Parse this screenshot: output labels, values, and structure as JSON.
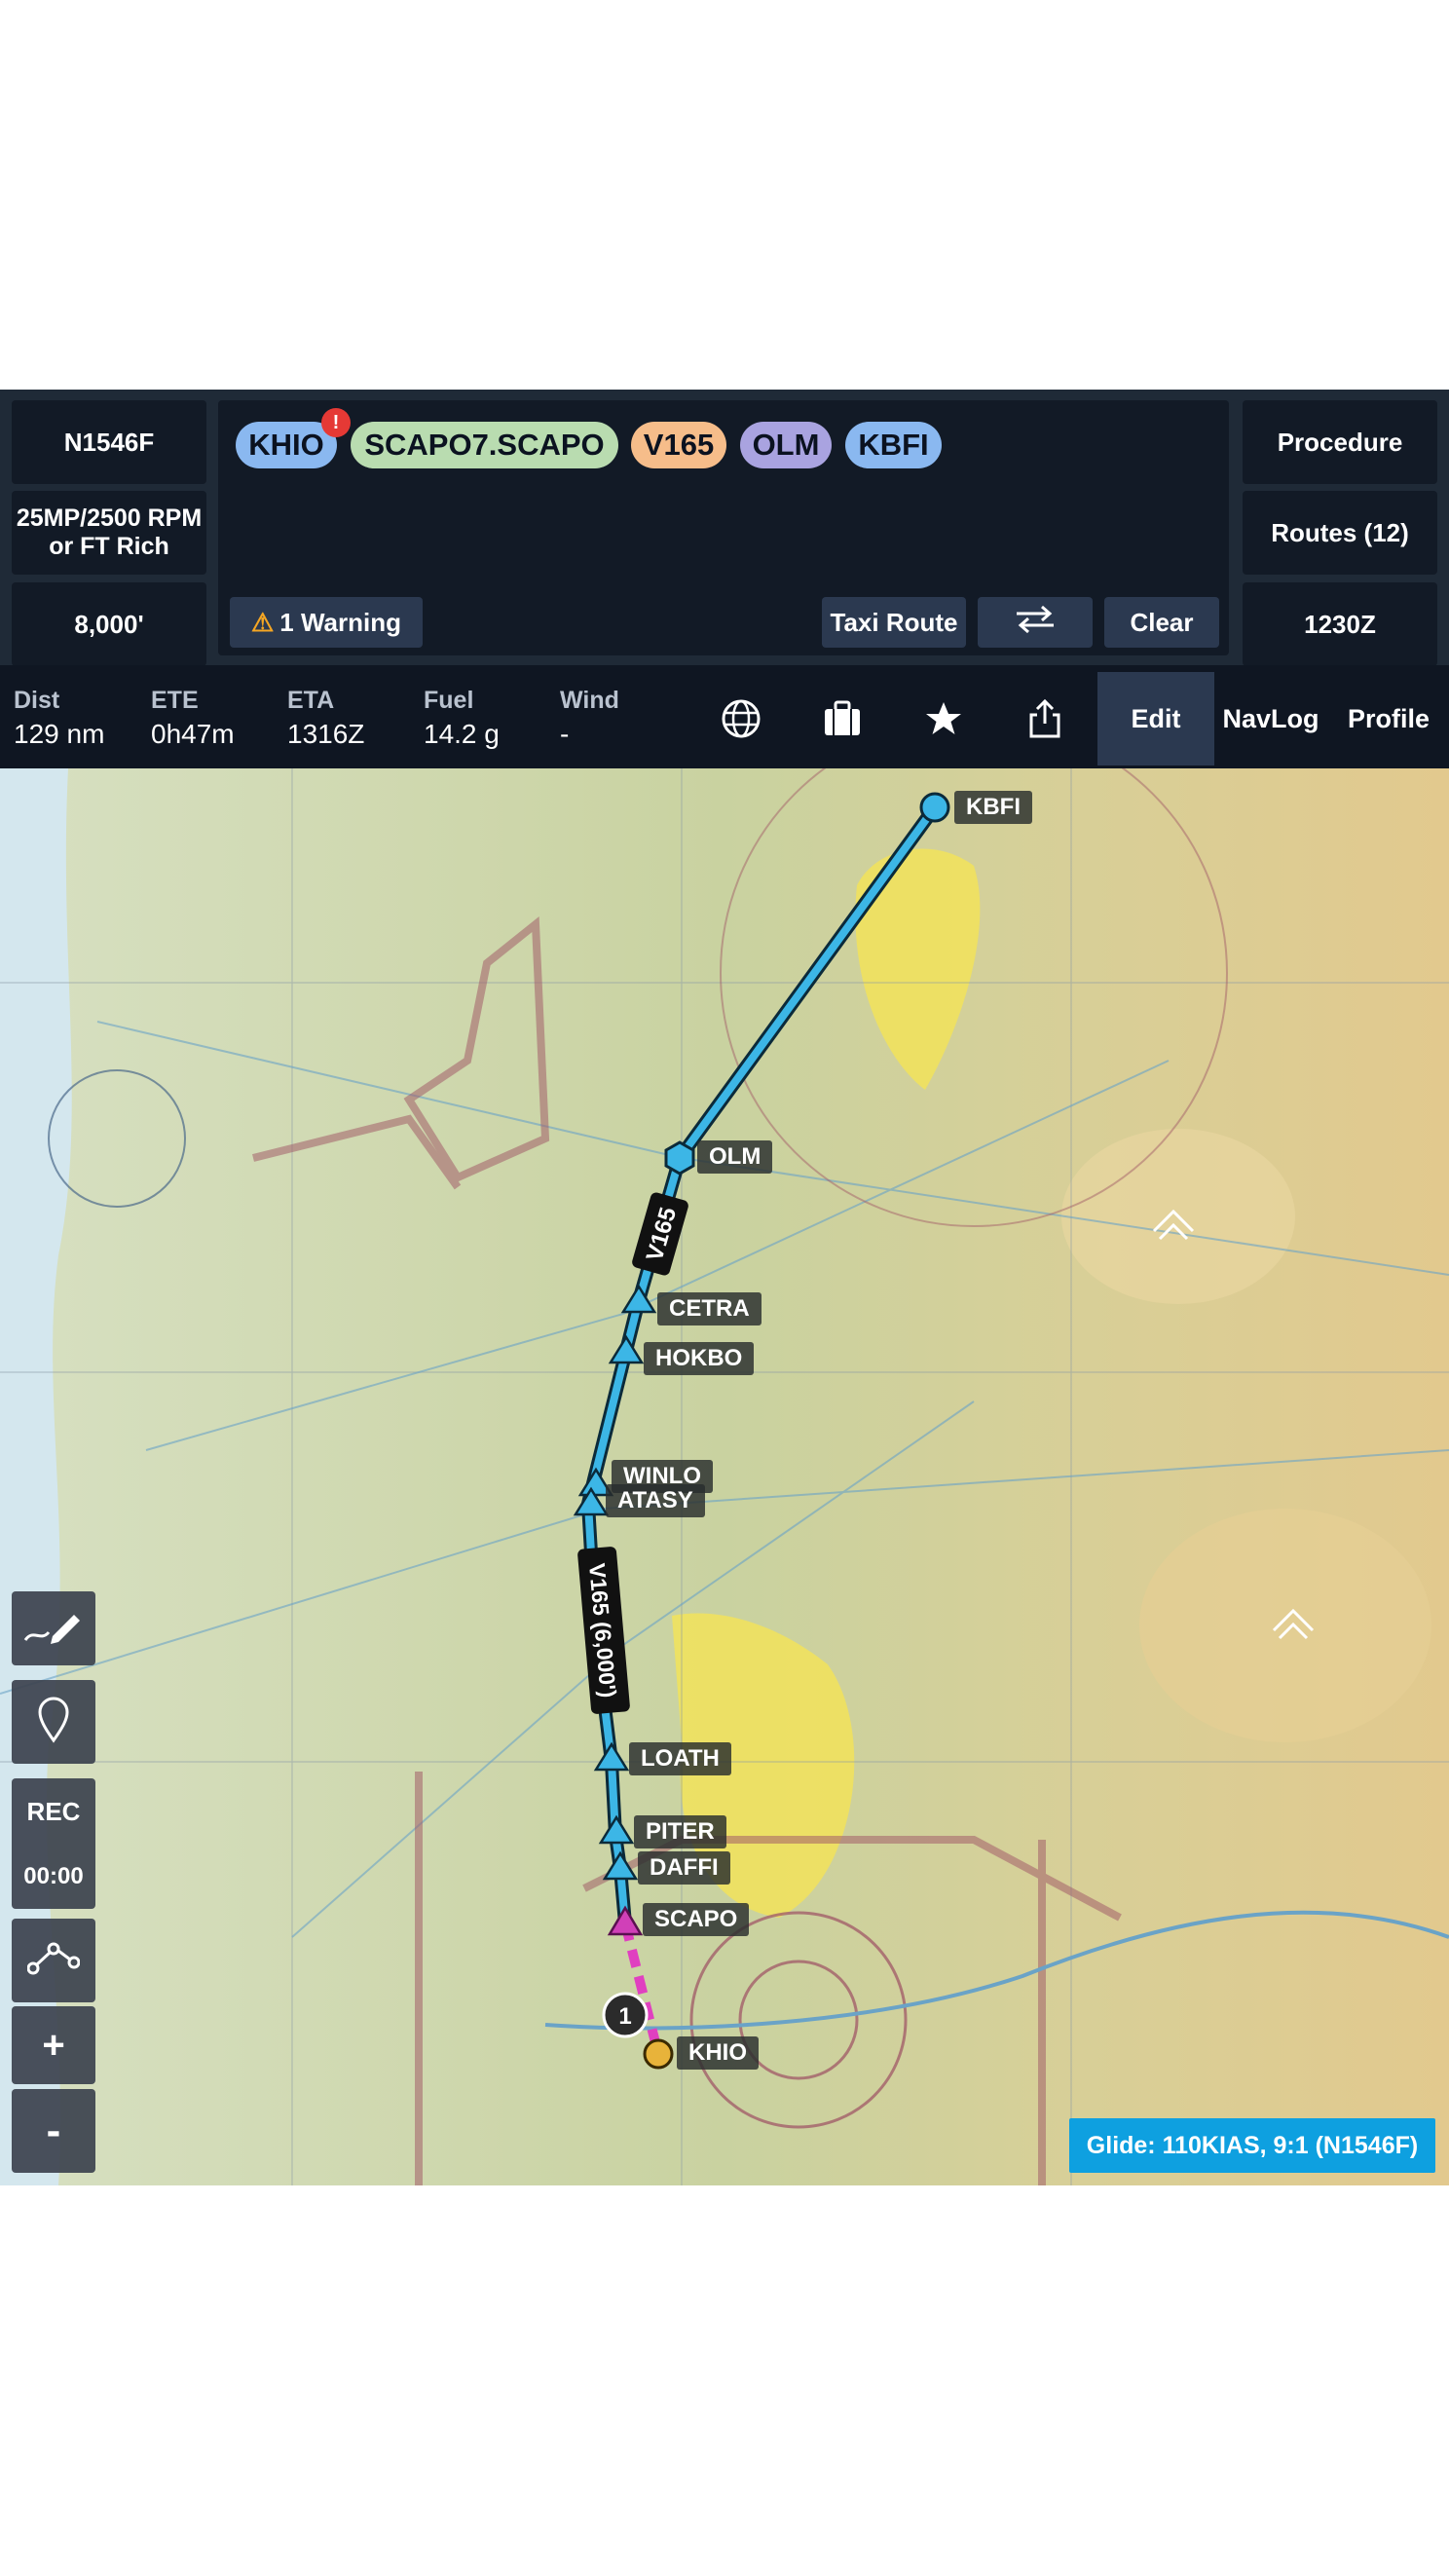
{
  "aircraft": {
    "tail": "N1546F",
    "power_setting": "25MP/2500 RPM or FT Rich",
    "altitude": "8,000'"
  },
  "route": {
    "items": [
      {
        "label": "KHIO",
        "color": "#8ab8f0"
      },
      {
        "label": "SCAPO7.SCAPO",
        "color": "#b9dcb0"
      },
      {
        "label": "V165",
        "color": "#f6bd8a"
      },
      {
        "label": "OLM",
        "color": "#a9a3e0"
      },
      {
        "label": "KBFI",
        "color": "#8ab8f0"
      }
    ],
    "alert_badge": "!",
    "warning_label": "1 Warning",
    "taxi_route_label": "Taxi Route",
    "clear_label": "Clear"
  },
  "right_panel": {
    "procedure_label": "Procedure",
    "routes_label": "Routes (12)",
    "time_label": "1230Z"
  },
  "stats": {
    "dist": {
      "label": "Dist",
      "value": "129 nm"
    },
    "ete": {
      "label": "ETE",
      "value": "0h47m"
    },
    "eta": {
      "label": "ETA",
      "value": "1316Z"
    },
    "fuel": {
      "label": "Fuel",
      "value": "14.2 g"
    },
    "wind": {
      "label": "Wind",
      "value": "-"
    }
  },
  "tabs": {
    "edit": "Edit",
    "navlog": "NavLog",
    "profile": "Profile"
  },
  "icons": [
    "globe-icon",
    "briefcase-icon",
    "star-icon",
    "share-icon",
    "pencil-icon",
    "pin-icon",
    "route-tool-icon"
  ],
  "map_tools": {
    "rec_label": "REC",
    "timer": "00:00",
    "zoom_in": "+",
    "zoom_out": "-"
  },
  "map": {
    "waypoints": [
      {
        "id": "KBFI",
        "label": "KBFI"
      },
      {
        "id": "OLM",
        "label": "OLM"
      },
      {
        "id": "CETRA",
        "label": "CETRA"
      },
      {
        "id": "HOKBO",
        "label": "HOKBO"
      },
      {
        "id": "WINLO",
        "label": "WINLO"
      },
      {
        "id": "ATASY",
        "label": "ATASY"
      },
      {
        "id": "LOATH",
        "label": "LOATH"
      },
      {
        "id": "PITER",
        "label": "PITER"
      },
      {
        "id": "DAFFI",
        "label": "DAFFI"
      },
      {
        "id": "SCAPO",
        "label": "SCAPO"
      },
      {
        "id": "KHIO",
        "label": "KHIO"
      }
    ],
    "airway_label_upper": "V165",
    "airway_label_lower": "V165 (6,000')",
    "marker_number": "1",
    "route_color": "#3cb6e6",
    "departure_color": "#e040c0"
  },
  "glide_label": "Glide: 110KIAS, 9:1 (N1546F)"
}
